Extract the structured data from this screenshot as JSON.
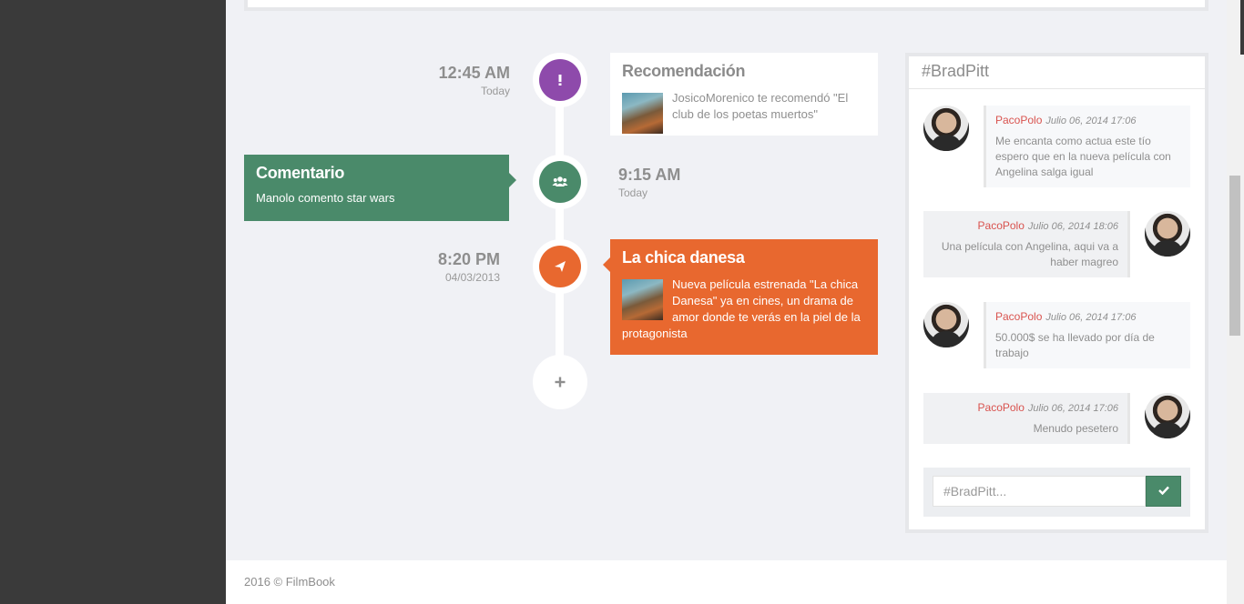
{
  "timeline": {
    "items": [
      {
        "time": "12:45 AM",
        "date": "Today",
        "title": "Recomendación",
        "text": "JosicoMorenico te recomendó \"El club de los poetas muertos\"",
        "color": "#8e4aab",
        "icon": "exclamation-icon"
      },
      {
        "time": "9:15 AM",
        "date": "Today",
        "title": "Comentario",
        "text": "Manolo comento star wars",
        "color": "#4a8a6a",
        "icon": "users-icon"
      },
      {
        "time": "8:20 PM",
        "date": "04/03/2013",
        "title": "La chica danesa",
        "text": "Nueva película estrenada \"La chica Danesa\" ya en cines, un drama de amor donde te verás en la piel de la protagonista",
        "color": "#e8682f",
        "icon": "send-icon"
      }
    ],
    "add_icon": "plus-icon"
  },
  "chat": {
    "title": "#BradPitt",
    "messages": [
      {
        "side": "left",
        "author": "PacoPolo",
        "date": "Julio 06, 2014 17:06",
        "text": "Me encanta como actua este tío espero que en la nueva película con Angelina salga igual"
      },
      {
        "side": "right",
        "author": "PacoPolo",
        "date": "Julio 06, 2014 18:06",
        "text": "Una película con Angelina, aqui va a haber magreo"
      },
      {
        "side": "left",
        "author": "PacoPolo",
        "date": "Julio 06, 2014 17:06",
        "text": "50.000$ se ha llevado por día de trabajo"
      },
      {
        "side": "right",
        "author": "PacoPolo",
        "date": "Julio 06, 2014 17:06",
        "text": "Menudo pesetero"
      }
    ],
    "input_placeholder": "#BradPitt...",
    "send_icon": "check-icon"
  },
  "footer": {
    "text": "2016 © FilmBook"
  },
  "colors": {
    "sidebar": "#3a3a3a",
    "background": "#f0f1f5",
    "accent_green": "#4a8a6a",
    "accent_orange": "#e8682f",
    "accent_purple": "#8e4aab",
    "author_red": "#d9534f"
  }
}
